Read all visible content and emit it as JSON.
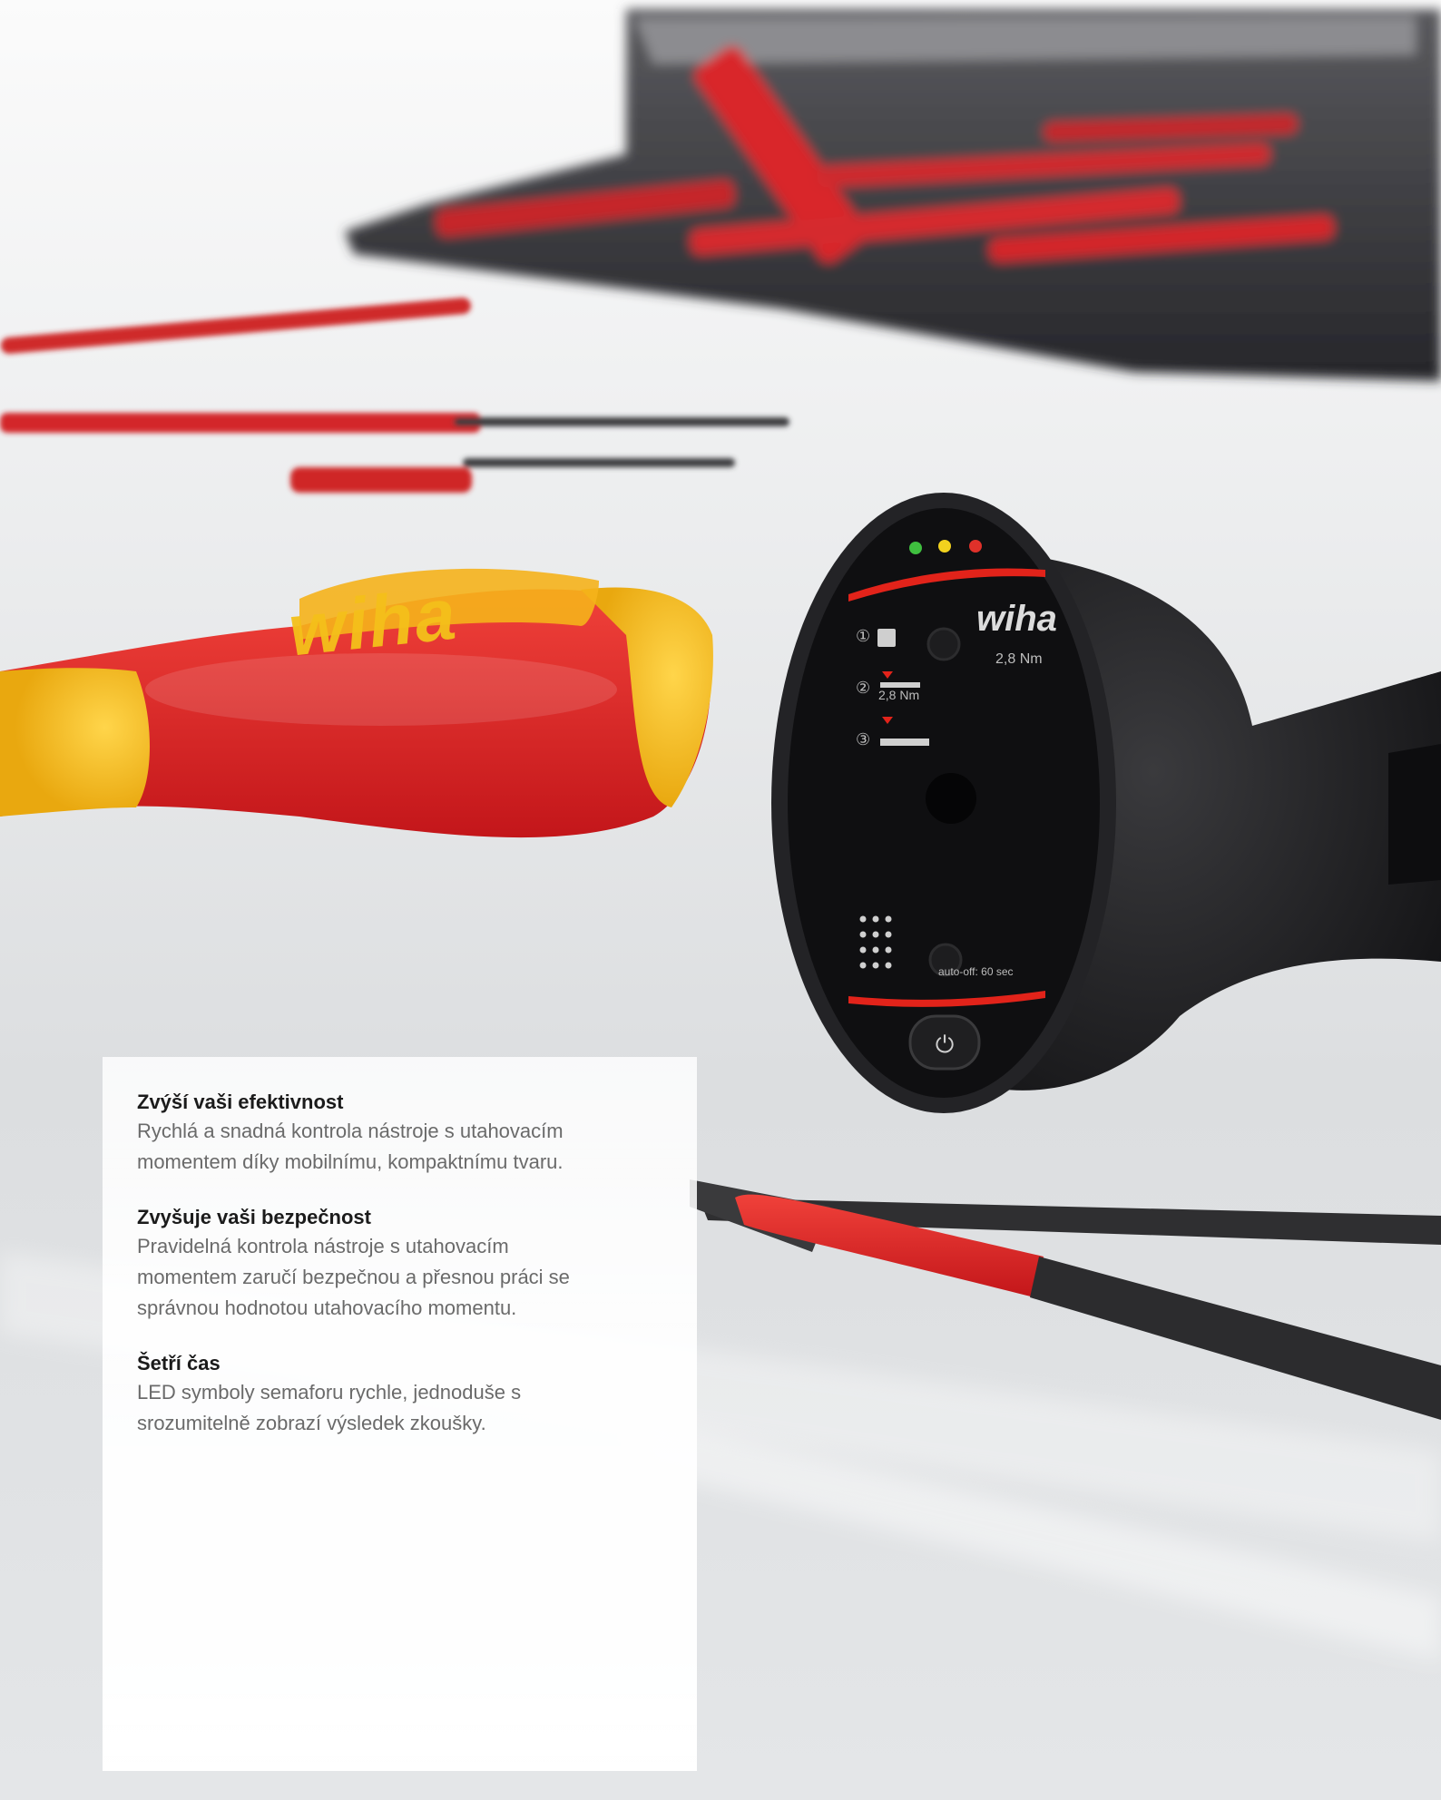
{
  "brand": {
    "logo": "wiha",
    "handle_logo": "wiha",
    "device_rating": "2,8 Nm",
    "step_1": "①",
    "step_2": "②",
    "step_2_value": "2,8 Nm",
    "step_3": "③",
    "auto_off": "auto-off: 60 sec"
  },
  "colors": {
    "accent_red": "#e2231a",
    "accent_yellow": "#f6c21b",
    "led_green": "#3fbf3f",
    "led_yellow": "#f2d21e",
    "led_red": "#e0312a",
    "device_body": "#1c1c1c"
  },
  "features": [
    {
      "title": "Zvýší vaši efektivnost",
      "text": "Rychlá a snadná kontrola nástroje s utahovacím\nmomentem díky mobilnímu, kompaktnímu tvaru."
    },
    {
      "title": "Zvyšuje vaši bezpečnost",
      "text": "Pravidelná kontrola nástroje s utahovacím\nmomentem zaručí bezpečnou a přesnou práci se\nsprávnou hodnotou utahovacího momentu."
    },
    {
      "title": "Šetří čas",
      "text": "LED symboly semaforu rychle, jednoduše s\nsrozumitelně zobrazí výsledek zkoušky."
    }
  ]
}
